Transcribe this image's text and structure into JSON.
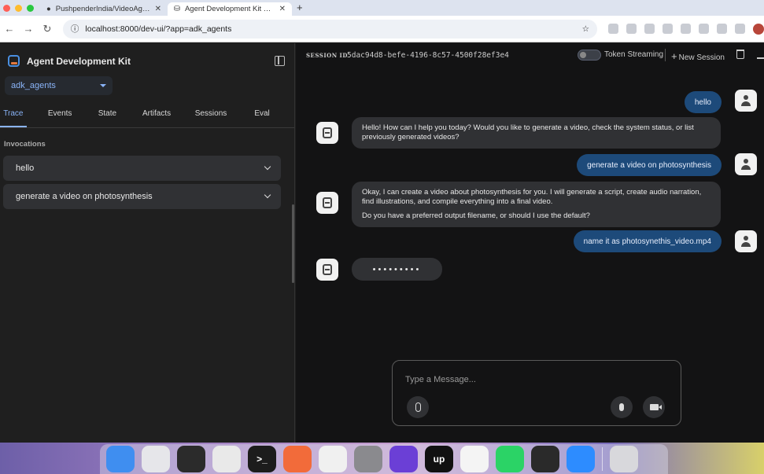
{
  "browser": {
    "tabs": [
      {
        "title": "PushpenderIndia/VideoAgent",
        "active": false
      },
      {
        "title": "Agent Development Kit Dev U",
        "active": true
      }
    ],
    "url": "localhost:8000/dev-ui/?app=adk_agents"
  },
  "sidebar": {
    "brand": "Agent Development Kit",
    "app_selected": "adk_agents",
    "tabs": [
      "Trace",
      "Events",
      "State",
      "Artifacts",
      "Sessions",
      "Eval"
    ],
    "active_tab": "Trace",
    "invocations_label": "Invocations",
    "invocations": [
      "hello",
      "generate a video on photosynthesis"
    ]
  },
  "header": {
    "session_label": "SESSION ID",
    "session_id": "5dac94d8-befe-4196-8c57-4500f28ef3e4",
    "token_streaming_label": "Token Streaming",
    "token_streaming_on": false,
    "new_session_label": "New Session"
  },
  "chat": {
    "messages": [
      {
        "role": "user",
        "text": "hello"
      },
      {
        "role": "bot",
        "paragraphs": [
          "Hello! How can I help you today? Would you like to generate a video, check the system status, or list previously generated videos?"
        ]
      },
      {
        "role": "user",
        "text": "generate a video on photosynthesis"
      },
      {
        "role": "bot",
        "paragraphs": [
          "Okay, I can create a video about photosynthesis for you. I will generate a script, create audio narration, find illustrations, and compile everything into a final video.",
          "Do you have a preferred output filename, or should I use the default?"
        ]
      },
      {
        "role": "user",
        "text": "name it as photosynethis_video.mp4"
      },
      {
        "role": "bot",
        "typing": "•••••••••"
      }
    ],
    "input_placeholder": "Type a Message..."
  },
  "dock": {
    "apps": [
      {
        "icon": "finder-icon",
        "color": "#3f8ef0",
        "glyph": ""
      },
      {
        "icon": "launchpad-icon",
        "color": "#e6e6ea",
        "glyph": ""
      },
      {
        "icon": "final-cut-icon",
        "color": "#2b2b2b",
        "glyph": ""
      },
      {
        "icon": "chrome-icon",
        "color": "#e9e9e9",
        "glyph": ""
      },
      {
        "icon": "terminal-icon",
        "color": "#1c1c1c",
        "glyph": ">_"
      },
      {
        "icon": "pencil-app-icon",
        "color": "#f26b3a",
        "glyph": ""
      },
      {
        "icon": "mongodb-icon",
        "color": "#f0f0f0",
        "glyph": ""
      },
      {
        "icon": "system-settings-icon",
        "color": "#8a8a8e",
        "glyph": ""
      },
      {
        "icon": "pen-app-icon",
        "color": "#6b3fd6",
        "glyph": ""
      },
      {
        "icon": "upwork-icon",
        "color": "#111111",
        "glyph": "up"
      },
      {
        "icon": "vscode-icon",
        "color": "#f4f4f4",
        "glyph": ""
      },
      {
        "icon": "whatsapp-icon",
        "color": "#2bd366",
        "glyph": ""
      },
      {
        "icon": "blocks-app-icon",
        "color": "#2a2a2a",
        "glyph": ""
      },
      {
        "icon": "zoom-icon",
        "color": "#2d8cff",
        "glyph": ""
      },
      {
        "icon": "trash-can-icon",
        "color": "#d8d8dc",
        "glyph": ""
      }
    ]
  }
}
